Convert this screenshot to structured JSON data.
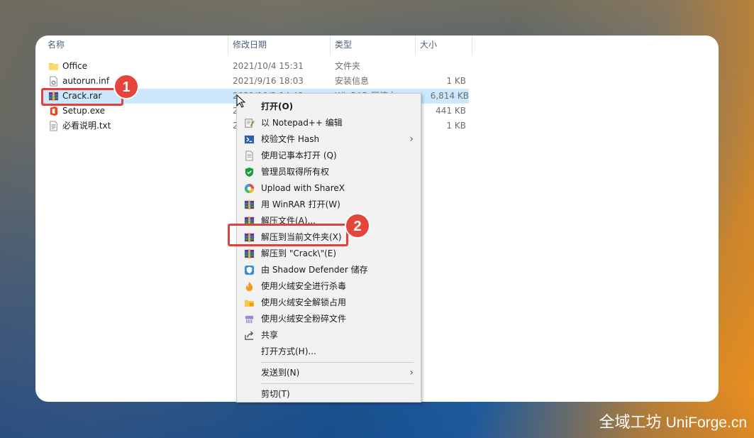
{
  "explorer": {
    "columns": {
      "name": "名称",
      "date": "修改日期",
      "type": "类型",
      "size": "大小"
    },
    "files": [
      {
        "name": "Office",
        "date": "2021/10/4 15:31",
        "type": "文件夹",
        "size": "",
        "icon": "folder-icon"
      },
      {
        "name": "autorun.inf",
        "date": "2021/9/16 18:03",
        "type": "安装信息",
        "size": "1 KB",
        "icon": "settings-file-icon"
      },
      {
        "name": "Crack.rar",
        "date": "2021/10/3 14:42",
        "type": "WinRAR 压缩文",
        "size": "6,814 KB",
        "icon": "winrar-icon",
        "selected": true
      },
      {
        "name": "Setup.exe",
        "date": "2",
        "type": "",
        "size": "441 KB",
        "icon": "office-icon"
      },
      {
        "name": "必看说明.txt",
        "date": "2",
        "type": "",
        "size": "1 KB",
        "icon": "text-file-icon"
      }
    ]
  },
  "context_menu": {
    "items": [
      {
        "label": "打开(O)",
        "icon": "",
        "bold": true
      },
      {
        "label": "以 Notepad++ 编辑",
        "icon": "notepadpp-icon"
      },
      {
        "label": "校验文件 Hash",
        "icon": "powershell-icon",
        "submenu": true
      },
      {
        "label": "使用记事本打开 (Q)",
        "icon": "notepad-icon"
      },
      {
        "label": "管理员取得所有权",
        "icon": "shield-check-icon"
      },
      {
        "label": "Upload with ShareX",
        "icon": "sharex-icon"
      },
      {
        "label": "用 WinRAR 打开(W)",
        "icon": "winrar-icon"
      },
      {
        "label": "解压文件(A)...",
        "icon": "winrar-icon"
      },
      {
        "label": "解压到当前文件夹(X)",
        "icon": "winrar-icon"
      },
      {
        "label": "解压到 \"Crack\\\"(E)",
        "icon": "winrar-icon"
      },
      {
        "label": "由 Shadow Defender 储存",
        "icon": "shadow-defender-icon"
      },
      {
        "label": "使用火绒安全进行杀毒",
        "icon": "huorong-icon"
      },
      {
        "label": "使用火绒安全解锁占用",
        "icon": "huorong-unlock-icon"
      },
      {
        "label": "使用火绒安全粉碎文件",
        "icon": "huorong-shred-icon"
      },
      {
        "label": "共享",
        "icon": "share-icon"
      },
      {
        "label": "打开方式(H)...",
        "icon": ""
      }
    ],
    "send_to": "发送到(N)",
    "cut": "剪切(T)"
  },
  "annotations": {
    "step1": "1",
    "step2": "2"
  },
  "watermark": {
    "cn": "全域工坊",
    "en": "UniForge.cn"
  },
  "colors": {
    "highlight": "#e0413a",
    "selection": "#cce8ff"
  }
}
